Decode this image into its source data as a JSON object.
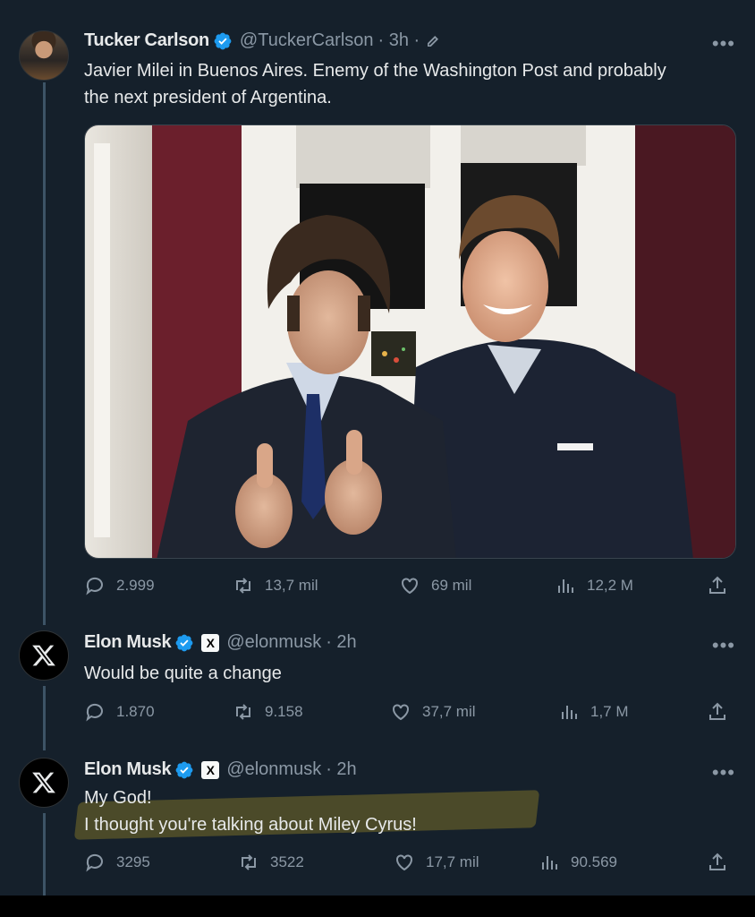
{
  "tweets": [
    {
      "name": "Tucker Carlson",
      "handle": "@TuckerCarlson",
      "time": "· 3h ·",
      "text_line1": "Javier Milei in Buenos Aires. Enemy of the Washington Post and probably",
      "text_line2": "the next president of Argentina.",
      "stats": {
        "replies": "2.999",
        "reposts": "13,7 mil",
        "likes": "69 mil",
        "views": "12,2 M"
      }
    },
    {
      "name": "Elon Musk",
      "handle": "@elonmusk",
      "time": "· 2h",
      "text_line1": "Would be quite a change",
      "stats": {
        "replies": "1.870",
        "reposts": "9.158",
        "likes": "37,7 mil",
        "views": "1,7 M"
      }
    },
    {
      "name": "Elon Musk",
      "handle": "@elonmusk",
      "time": "· 2h",
      "text_line1": "My God!",
      "text_line2": "I thought you're talking about Miley Cyrus!",
      "stats": {
        "replies": "3295",
        "reposts": "3522",
        "likes": "17,7 mil",
        "views": "90.569"
      }
    }
  ],
  "more_label": "•••",
  "affiliate_badge": "X",
  "colors": {
    "background": "#15202b",
    "text": "#e7e9ea",
    "muted": "#8b98a5",
    "verified": "#1d9bf0",
    "thread_line": "#3d5466"
  },
  "icons": [
    "more-icon",
    "verified-icon",
    "edit-icon",
    "reply-icon",
    "repost-icon",
    "like-icon",
    "views-icon",
    "share-icon",
    "x-logo-icon"
  ]
}
